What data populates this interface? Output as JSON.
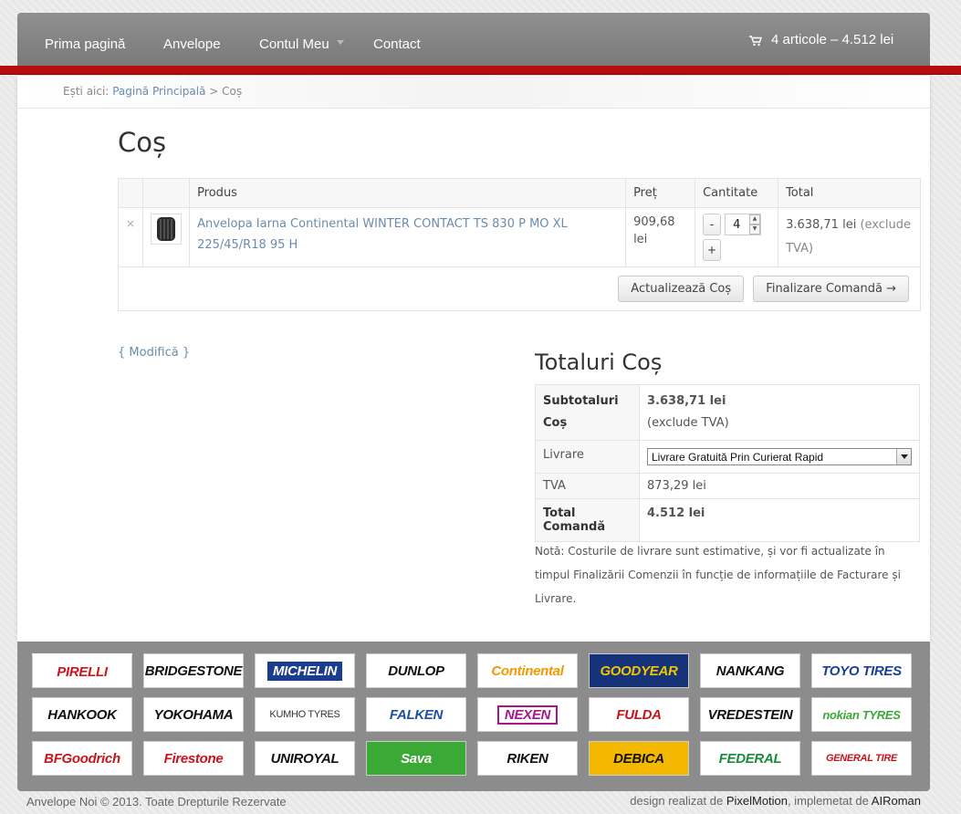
{
  "nav": {
    "items": [
      "Prima pagină",
      "Anvelope",
      "Contul Meu",
      "Contact"
    ],
    "cart_summary": "4 articole – 4.512 lei"
  },
  "breadcrumb": {
    "prefix": "Ești aici:",
    "home": "Pagină Principală",
    "separator": ">",
    "current": "Coș"
  },
  "page_title": "Coș",
  "cart_table": {
    "headers": [
      "Produs",
      "Preț",
      "Cantitate",
      "Total"
    ],
    "row": {
      "remove": "×",
      "product": "Anvelopa Iarna Continental WINTER CONTACT TS 830 P MO XL 225/45/R18 95 H",
      "price": "909,68 lei",
      "qty_minus": "-",
      "qty": "4",
      "qty_plus": "+",
      "total": "3.638,71 lei",
      "total_note": "(exclude TVA)"
    },
    "update_button": "Actualizează Coș",
    "checkout_button": "Finalizare Comandă →"
  },
  "modify_link": "{ Modifică }",
  "totals": {
    "title": "Totaluri Coș",
    "subtotal_label": "Subtotaluri Coș",
    "subtotal_value": "3.638,71 lei",
    "subtotal_note": "(exclude TVA)",
    "shipping_label": "Livrare",
    "shipping_selected": "Livrare Gratuită Prin Curierat Rapid",
    "tax_label": "TVA",
    "tax_value": "873,29 lei",
    "order_total_label": "Total Comandă",
    "order_total_value": "4.512 lei"
  },
  "note": "Notă: Costurile de livrare sunt estimative, și vor fi actualizate în timpul Finalizării Comenzii în funcție de informațiile de Facturare și Livrare.",
  "brands": [
    {
      "name": "PIRELLI",
      "color": "#d3131b"
    },
    {
      "name": "BRIDGESTONE",
      "color": "#111111"
    },
    {
      "name": "MICHELIN",
      "color": "#1b3d8f"
    },
    {
      "name": "DUNLOP",
      "color": "#111111"
    },
    {
      "name": "Continental",
      "color": "#f39a00"
    },
    {
      "name": "GOODYEAR",
      "color": "#f3c500"
    },
    {
      "name": "NANKANG",
      "color": "#111111"
    },
    {
      "name": "TOYO TIRES",
      "color": "#1a3f9a"
    },
    {
      "name": "HANKOOK",
      "color": "#111111"
    },
    {
      "name": "YOKOHAMA",
      "color": "#111111"
    },
    {
      "name": "KUMHO TYRES",
      "color": "#333333"
    },
    {
      "name": "FALKEN",
      "color": "#1e4fa0"
    },
    {
      "name": "NEXEN",
      "color": "#a8168a"
    },
    {
      "name": "FULDA",
      "color": "#c4161c"
    },
    {
      "name": "VREDESTEIN",
      "color": "#111111"
    },
    {
      "name": "nokian TYRES",
      "color": "#3aa935"
    },
    {
      "name": "BFGoodrich",
      "color": "#c4161c"
    },
    {
      "name": "Firestone",
      "color": "#c4161c"
    },
    {
      "name": "UNIROYAL",
      "color": "#111111"
    },
    {
      "name": "Sava",
      "color": "#ffffff"
    },
    {
      "name": "RIKEN",
      "color": "#111111"
    },
    {
      "name": "DEBICA",
      "color": "#111111"
    },
    {
      "name": "FEDERAL",
      "color": "#1c8a3a"
    },
    {
      "name": "GENERAL TIRE",
      "color": "#c4161c"
    }
  ],
  "footer": {
    "copyright": "Anvelope Noi © 2013. Toate Drepturile Rezervate",
    "design_prefix": "design realizat de",
    "designer": "PixelMotion",
    "impl_prefix": ", implemetat de",
    "implementer": "AIRoman"
  }
}
